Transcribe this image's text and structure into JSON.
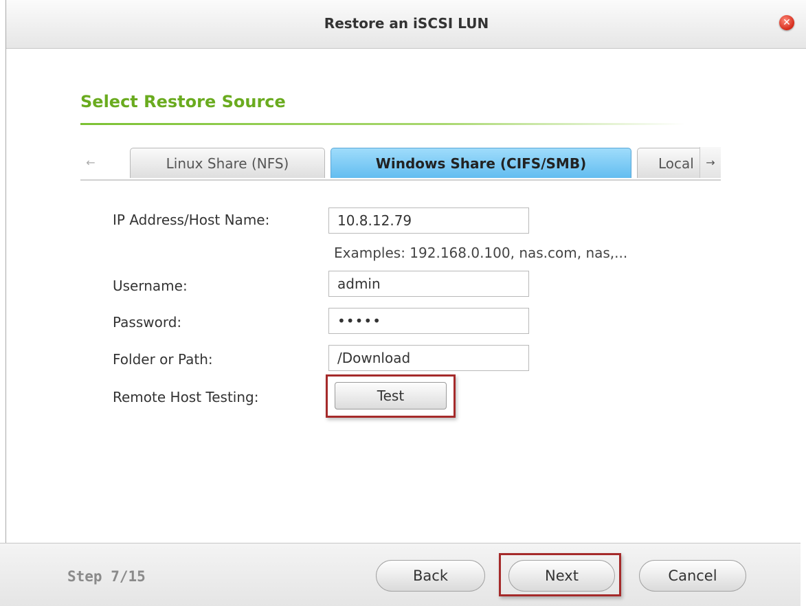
{
  "window": {
    "title": "Restore an iSCSI LUN",
    "close_icon": "close-icon"
  },
  "section": {
    "title": "Select Restore Source"
  },
  "tabs": {
    "left_arrow_icon": "arrow-left-icon",
    "right_arrow_icon": "arrow-right-icon",
    "items": [
      {
        "label": "Linux Share (NFS)",
        "active": false
      },
      {
        "label": "Windows Share (CIFS/SMB)",
        "active": true
      },
      {
        "label": "Local",
        "active": false
      }
    ]
  },
  "form": {
    "ip_label": "IP Address/Host Name:",
    "ip_value": "10.8.12.79",
    "ip_hint": "Examples: 192.168.0.100, nas.com, nas,...",
    "username_label": "Username:",
    "username_value": "admin",
    "password_label": "Password:",
    "password_value": "•••••",
    "folder_label": "Folder or Path:",
    "folder_value": "/Download",
    "test_label": "Remote Host Testing:",
    "test_button": "Test"
  },
  "footer": {
    "step": "Step 7/15",
    "back": "Back",
    "next": "Next",
    "cancel": "Cancel"
  },
  "colors": {
    "accent_green": "#6aab1f",
    "active_tab_blue": "#63bdf0",
    "highlight_red": "#a52a2a"
  }
}
